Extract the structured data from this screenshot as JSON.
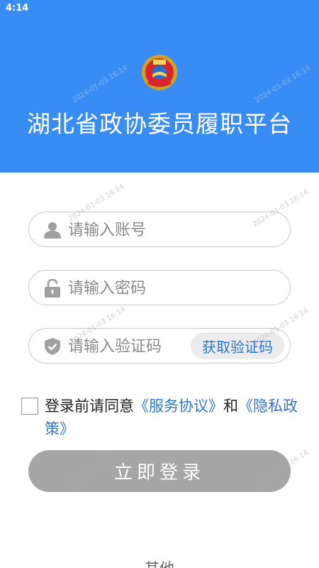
{
  "status_bar": {
    "time": "4:14"
  },
  "header": {
    "title": "湖北省政协委员履职平台"
  },
  "login_form": {
    "account_placeholder": "请输入账号",
    "password_placeholder": "请输入密码",
    "code_placeholder": "请输入验证码",
    "get_code_label": "获取验证码"
  },
  "agreement": {
    "prefix": "登录前请同意",
    "service_link": "《服务协议》",
    "connector": "和",
    "privacy_link": "《隐私政策》",
    "checked": false
  },
  "login_button": "立即登录",
  "other_label": "其他",
  "watermark": "2024-01-03 16:14",
  "colors": {
    "header_bg": "#3a8cf5",
    "link": "#2f76c9",
    "button_disabled": "#a6a6a6"
  },
  "icons": [
    "emblem-icon",
    "user-icon",
    "lock-icon",
    "shield-check-icon"
  ]
}
